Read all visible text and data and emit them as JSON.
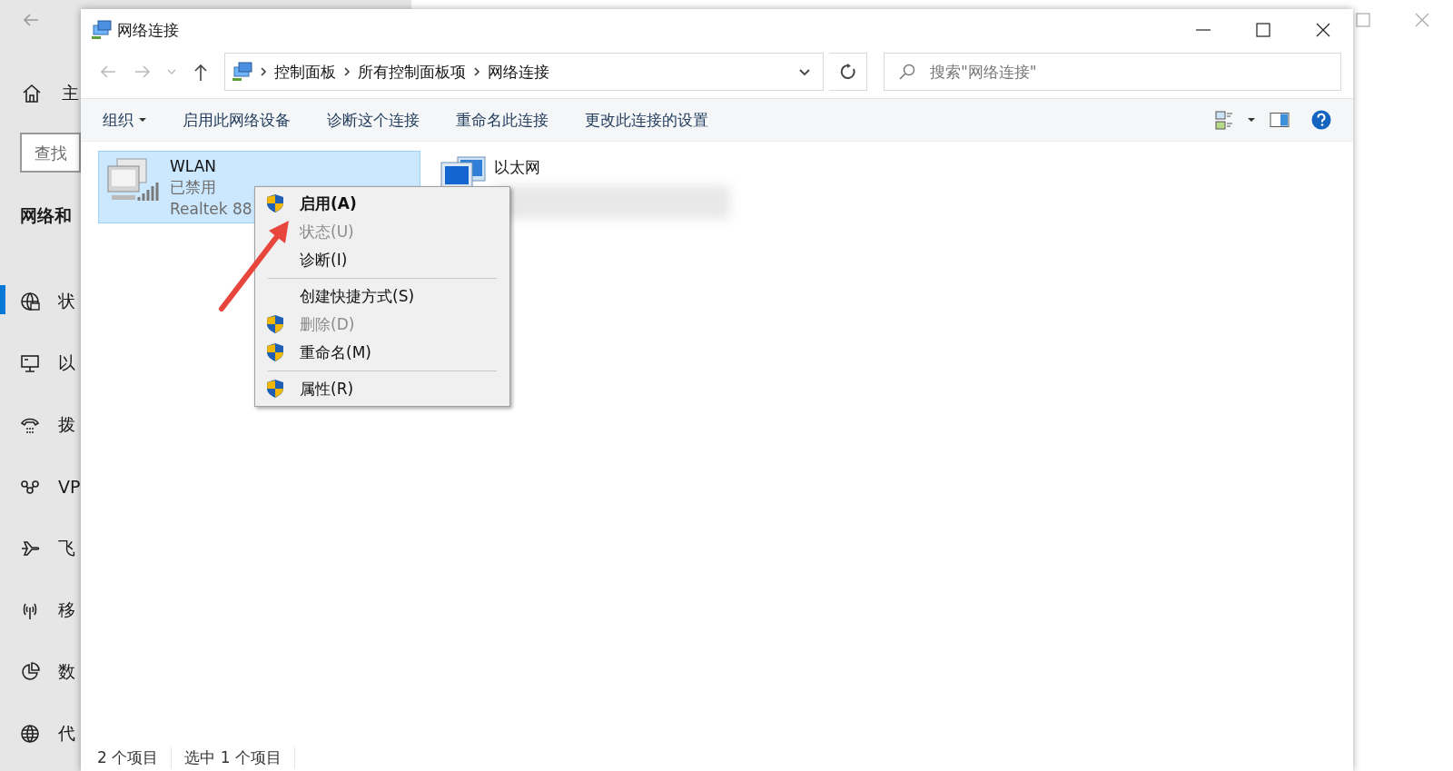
{
  "settings_window": {
    "search": {
      "placeholder": "查找"
    },
    "home_label": "主",
    "heading": "网络和",
    "nav": [
      {
        "kind": "status",
        "label": "状",
        "selected": true
      },
      {
        "kind": "ethernet",
        "label": "以",
        "selected": false
      },
      {
        "kind": "dialup",
        "label": "拨",
        "selected": false
      },
      {
        "kind": "vpn",
        "label": "VP",
        "selected": false
      },
      {
        "kind": "airplane",
        "label": "飞",
        "selected": false
      },
      {
        "kind": "cellular",
        "label": "移",
        "selected": false
      },
      {
        "kind": "data",
        "label": "数",
        "selected": false
      },
      {
        "kind": "proxy",
        "label": "代",
        "selected": false
      }
    ]
  },
  "window": {
    "title": "网络连接"
  },
  "address_bar": {
    "path": [
      "控制面板",
      "所有控制面板项",
      "网络连接"
    ]
  },
  "search": {
    "placeholder": "搜索\"网络连接\""
  },
  "toolbar": {
    "items": [
      {
        "label": "组织",
        "has_menu": true
      },
      {
        "label": "启用此网络设备",
        "has_menu": false
      },
      {
        "label": "诊断这个连接",
        "has_menu": false
      },
      {
        "label": "重命名此连接",
        "has_menu": false
      },
      {
        "label": "更改此连接的设置",
        "has_menu": false
      }
    ]
  },
  "connections": [
    {
      "kind": "wireless",
      "name": "WLAN",
      "status": "已禁用",
      "device": "Realtek 88",
      "selected": true
    },
    {
      "kind": "wired",
      "name": "以太网",
      "selected": false
    }
  ],
  "context_menu": {
    "items": [
      {
        "kind": "item",
        "label": "启用(A)",
        "shield": true,
        "disabled": false,
        "default": true
      },
      {
        "kind": "item",
        "label": "状态(U)",
        "shield": false,
        "disabled": true,
        "default": false
      },
      {
        "kind": "item",
        "label": "诊断(I)",
        "shield": false,
        "disabled": false,
        "default": false
      },
      {
        "kind": "separator"
      },
      {
        "kind": "item",
        "label": "创建快捷方式(S)",
        "shield": false,
        "disabled": false,
        "default": false
      },
      {
        "kind": "item",
        "label": "删除(D)",
        "shield": true,
        "disabled": true,
        "default": false
      },
      {
        "kind": "item",
        "label": "重命名(M)",
        "shield": true,
        "disabled": false,
        "default": false
      },
      {
        "kind": "separator"
      },
      {
        "kind": "item",
        "label": "属性(R)",
        "shield": true,
        "disabled": false,
        "default": false
      }
    ]
  },
  "status_bar": [
    "2 个项目",
    "选中 1 个项目"
  ]
}
